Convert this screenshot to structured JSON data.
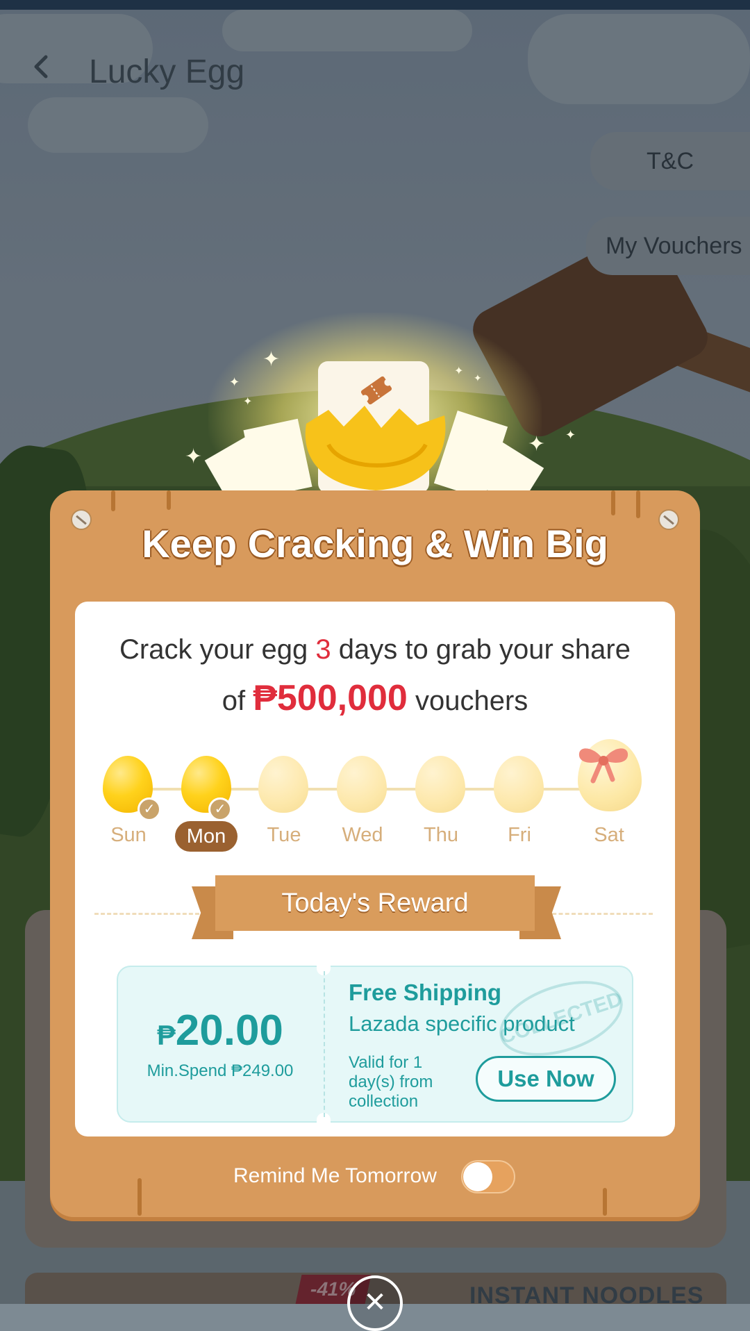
{
  "header": {
    "title": "Lucky Egg",
    "back_icon": "back-arrow-icon"
  },
  "side_buttons": {
    "tc": "T&C",
    "vouchers": "My Vouchers"
  },
  "modal": {
    "title": "Keep Cracking & Win Big",
    "message": {
      "part1": "Crack your egg ",
      "days": "3",
      "part2": " days to grab your share",
      "part3": "of ",
      "amount": "₱500,000",
      "part4": " vouchers"
    },
    "days": [
      {
        "label": "Sun",
        "cracked": true
      },
      {
        "label": "Mon",
        "cracked": true,
        "today": true
      },
      {
        "label": "Tue",
        "cracked": false
      },
      {
        "label": "Wed",
        "cracked": false
      },
      {
        "label": "Thu",
        "cracked": false
      },
      {
        "label": "Fri",
        "cracked": false
      },
      {
        "label": "Sat",
        "cracked": false,
        "gift": true
      }
    ],
    "reward_title": "Today's Reward",
    "voucher": {
      "currency": "₱",
      "amount": "20.00",
      "min_spend": "Min.Spend ₱249.00",
      "type": "Free Shipping",
      "scope": "Lazada specific product",
      "validity": "Valid for 1 day(s) from collection",
      "stamp": "COLLECTED",
      "cta": "Use Now"
    },
    "remind_label": "Remind Me Tomorrow",
    "remind_enabled": false
  },
  "background_promo": {
    "discount": "-41%",
    "label": "INSTANT NOODLES"
  },
  "colors": {
    "modal": "#d89a5c",
    "accent_red": "#e02d3c",
    "teal": "#1e9c9c"
  }
}
